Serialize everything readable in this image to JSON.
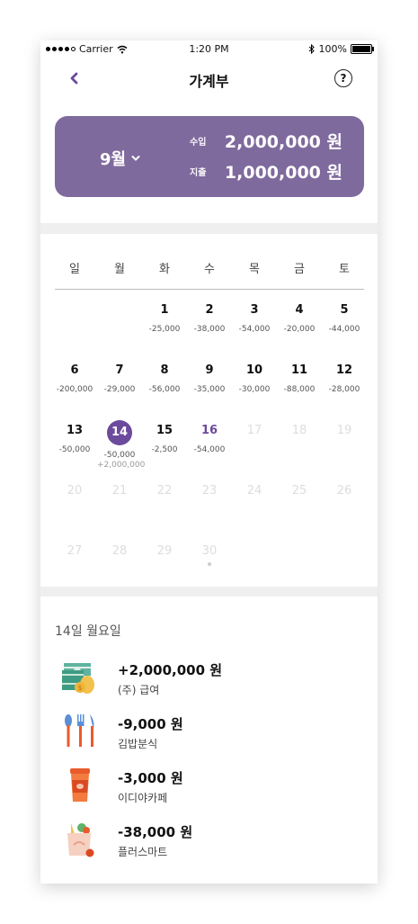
{
  "status": {
    "carrier": "Carrier",
    "time": "1:20 PM",
    "battery": "100%"
  },
  "header": {
    "title": "가계부",
    "help_icon": "?"
  },
  "summary": {
    "month": "9월",
    "income_label": "수입",
    "income": "2,000,000 원",
    "expense_label": "지출",
    "expense": "1,000,000 원",
    "bg_color": "#7f6a9d"
  },
  "calendar": {
    "weekdays": [
      "일",
      "월",
      "화",
      "수",
      "목",
      "금",
      "토"
    ],
    "days": [
      {
        "d": "1",
        "exp": "-25,000"
      },
      {
        "d": "2",
        "exp": "-38,000"
      },
      {
        "d": "3",
        "exp": "-54,000"
      },
      {
        "d": "4",
        "exp": "-20,000"
      },
      {
        "d": "5",
        "exp": "-44,000"
      },
      {
        "d": "6",
        "exp": "-200,000"
      },
      {
        "d": "7",
        "exp": "-29,000"
      },
      {
        "d": "8",
        "exp": "-56,000"
      },
      {
        "d": "9",
        "exp": "-35,000"
      },
      {
        "d": "10",
        "exp": "-30,000"
      },
      {
        "d": "11",
        "exp": "-88,000"
      },
      {
        "d": "12",
        "exp": "-28,000"
      },
      {
        "d": "13",
        "exp": "-50,000"
      },
      {
        "d": "14",
        "exp": "-50,000",
        "inc": "+2,000,000"
      },
      {
        "d": "15",
        "exp": "-2,500"
      },
      {
        "d": "16",
        "exp": "-54,000"
      },
      {
        "d": "17"
      },
      {
        "d": "18"
      },
      {
        "d": "19"
      },
      {
        "d": "20"
      },
      {
        "d": "21"
      },
      {
        "d": "22"
      },
      {
        "d": "23"
      },
      {
        "d": "24"
      },
      {
        "d": "25"
      },
      {
        "d": "26"
      },
      {
        "d": "27"
      },
      {
        "d": "28"
      },
      {
        "d": "29"
      },
      {
        "d": "30"
      }
    ],
    "selected_day": "14",
    "today": "16",
    "accent": "#6c4a9c"
  },
  "list": {
    "date": "14일 월요일",
    "items": [
      {
        "amount": "+2,000,000 원",
        "name": "(주) 급여",
        "icon": "money-icon"
      },
      {
        "amount": "-9,000 원",
        "name": "김밥분식",
        "icon": "utensils-icon"
      },
      {
        "amount": "-3,000 원",
        "name": "이디야카페",
        "icon": "coffee-cup-icon"
      },
      {
        "amount": "-38,000 원",
        "name": "플러스마트",
        "icon": "grocery-bag-icon"
      }
    ]
  }
}
